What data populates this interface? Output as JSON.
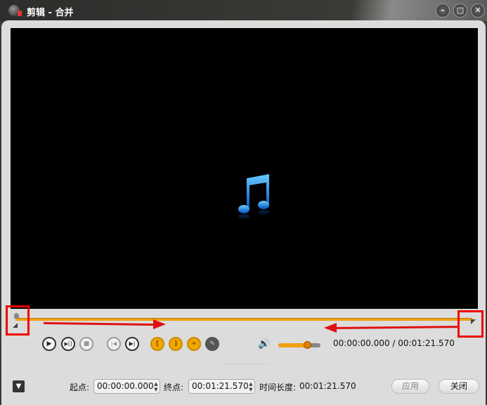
{
  "window": {
    "title": "剪辑 - 合并",
    "minimize": "–",
    "maximize": "□",
    "close": "✕"
  },
  "controls": {
    "play": "▶",
    "play_selection": "▶[]",
    "stop": "■",
    "prev": "|◀",
    "next": "▶|",
    "set_start": "[",
    "set_end": "]",
    "add_clip": "+",
    "edit": "✎",
    "volume_icon": "🔊",
    "volume_level": 0.68,
    "time_display": "00:00:00.000 / 00:01:21.570",
    "grip": "˙˙˙˙˙˙˙˙˙˙˙˙"
  },
  "bottom": {
    "expand_icon": "▼",
    "start_label": "起点:",
    "start_value": "00:00:00.000",
    "end_label": "终点:",
    "end_value": "00:01:21.570",
    "duration_label": "时间长度:",
    "duration_value": "00:01:21.570",
    "apply": "应用",
    "close": "关闭",
    "spin": "▲▼"
  }
}
